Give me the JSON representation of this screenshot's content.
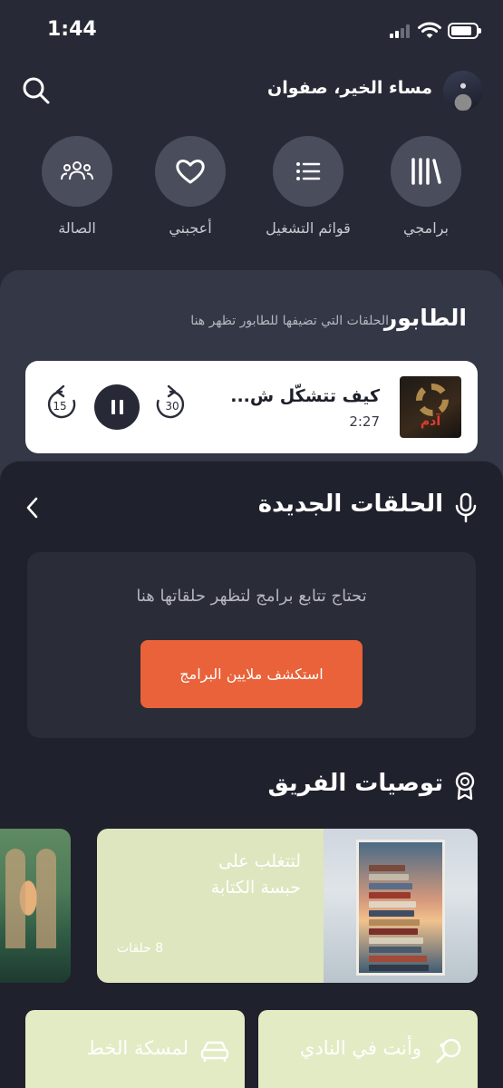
{
  "status_bar": {
    "time": "1:44"
  },
  "header": {
    "greeting": "مساء الخير، صفوان"
  },
  "quick_actions": [
    {
      "label": "برامجي",
      "icon": "library-icon"
    },
    {
      "label": "قوائم التشغيل",
      "icon": "list-icon"
    },
    {
      "label": "أعجبني",
      "icon": "heart-icon"
    },
    {
      "label": "الصالة",
      "icon": "people-icon"
    }
  ],
  "queue": {
    "title": "الطابور",
    "subtitle": "الحلقات التي تضيفها للطابور تظهر هنا",
    "player": {
      "episode_title": "كيف تتشكّل ش...",
      "time_remaining": "2:27",
      "thumb_text": "آدم",
      "rewind_label": "15",
      "forward_label": "30"
    }
  },
  "new_episodes": {
    "title": "الحلقات الجديدة",
    "empty_message": "تحتاج تتابع برامج لتظهر حلقاتها هنا",
    "discover_button": "استكشف ملايين البرامج"
  },
  "recommendations": {
    "title": "توصيات الفريق",
    "cards": [
      {
        "title_line1": "لتتغلب على",
        "title_line2": "حبسة الكتابة",
        "count": "8 حلقات"
      }
    ]
  },
  "chips": [
    {
      "label": "وأنت في النادي",
      "icon": "tennis-racket-icon"
    },
    {
      "label": "لمسكة الخط",
      "icon": "car-icon"
    }
  ],
  "colors": {
    "background": "#272a36",
    "accent": "#e9623a",
    "card_green": "#dde6be"
  }
}
